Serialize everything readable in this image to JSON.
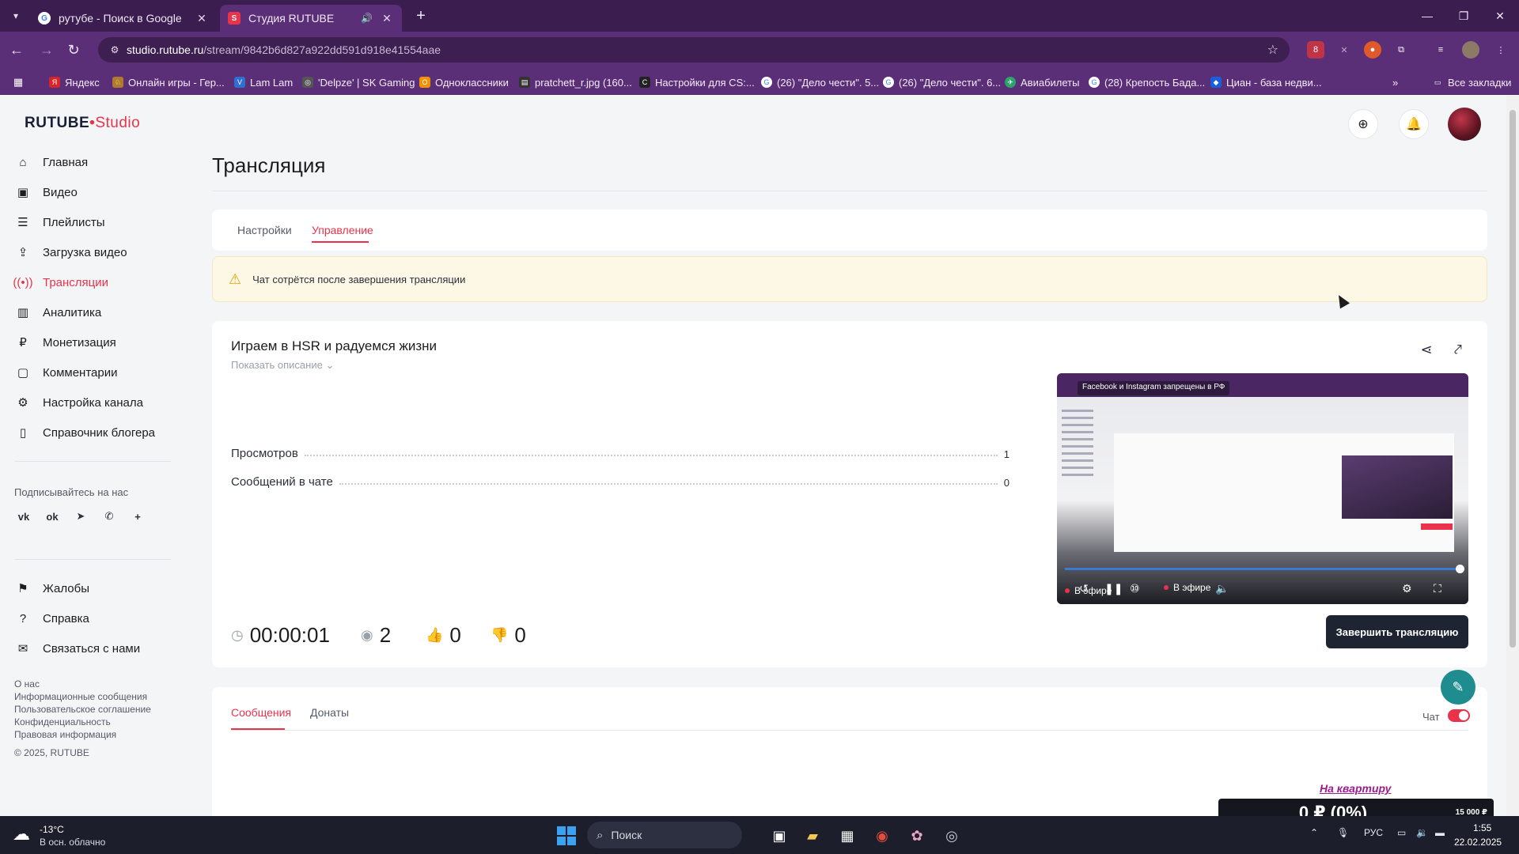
{
  "browser": {
    "tabs": [
      {
        "title": "рутубе - Поиск в Google",
        "favicon": "google-icon"
      },
      {
        "title": "Студия RUTUBE",
        "favicon": "rutube-icon"
      }
    ],
    "url_host": "studio.rutube.ru",
    "url_path": "/stream/9842b6d827a922dd591d918e41554aae",
    "bookmarks": [
      "Яндекс",
      "Онлайн игры - Гер...",
      "Lam Lam",
      "'Delpze' | SK Gaming",
      "Одноклассники",
      "pratchett_r.jpg (160...",
      "Настройки для CS:...",
      "(26) \"Дело чести\". 5...",
      "(26) \"Дело чести\". 6...",
      "Авиабилеты",
      "(28) Крепость Бада...",
      "Циан - база недви..."
    ],
    "all_bookmarks": "Все закладки",
    "ext_badge": "8"
  },
  "studio": {
    "logo_main": "RUTUBE",
    "logo_suffix": "Studio",
    "sidebar": [
      {
        "label": "Главная",
        "icon": "home-icon"
      },
      {
        "label": "Видео",
        "icon": "video-icon"
      },
      {
        "label": "Плейлисты",
        "icon": "playlist-icon"
      },
      {
        "label": "Загрузка видео",
        "icon": "upload-icon"
      },
      {
        "label": "Трансляции",
        "icon": "broadcast-icon"
      },
      {
        "label": "Аналитика",
        "icon": "analytics-icon"
      },
      {
        "label": "Монетизация",
        "icon": "money-icon"
      },
      {
        "label": "Комментарии",
        "icon": "comment-icon"
      },
      {
        "label": "Настройка канала",
        "icon": "gear-icon"
      },
      {
        "label": "Справочник блогера",
        "icon": "book-icon"
      }
    ],
    "follow_title": "Подписывайтесь на нас",
    "sidebar_bottom": [
      {
        "label": "Жалобы",
        "icon": "flag-icon"
      },
      {
        "label": "Справка",
        "icon": "help-icon"
      },
      {
        "label": "Связаться с нами",
        "icon": "mail-icon"
      }
    ],
    "footer_links": [
      "О нас",
      "Информационные сообщения",
      "Пользовательское соглашение",
      "Конфиденциальность",
      "Правовая информация"
    ],
    "copyright": "© 2025, RUTUBE"
  },
  "page": {
    "title": "Трансляция",
    "tabs": [
      "Настройки",
      "Управление"
    ],
    "active_tab": "Управление",
    "warning": "Чат сотрётся после завершения трансляции",
    "stream_title": "Играем в HSR и радуемся жизни",
    "show_description": "Показать описание",
    "stats": [
      {
        "label": "Просмотров",
        "value": "1"
      },
      {
        "label": "Сообщений в чате",
        "value": "0"
      }
    ],
    "metrics": {
      "duration": "00:00:01",
      "viewers": "2",
      "likes": "0",
      "dislikes": "0"
    },
    "player": {
      "banner": "Facebook и Instagram запрещены в РФ",
      "live_label": "В эфире",
      "progress": 1.0
    },
    "end_button": "Завершить трансляцию",
    "chat_tabs": [
      "Сообщения",
      "Донаты"
    ],
    "chat_toggle_label": "Чат",
    "chat_enabled": true
  },
  "donation_overlay": {
    "label": "На квартиру",
    "amount": "0 ₽ (0%)",
    "goal": "15 000 ₽"
  },
  "taskbar": {
    "weather_temp": "-13°C",
    "weather_desc": "В осн. облачно",
    "search_placeholder": "Поиск",
    "lang": "РУС",
    "time": "1:55",
    "date": "22.02.2025"
  },
  "colors": {
    "accent": "#e8334a",
    "browser_frame": "#5b2f78",
    "dark_button": "#1f2433"
  }
}
